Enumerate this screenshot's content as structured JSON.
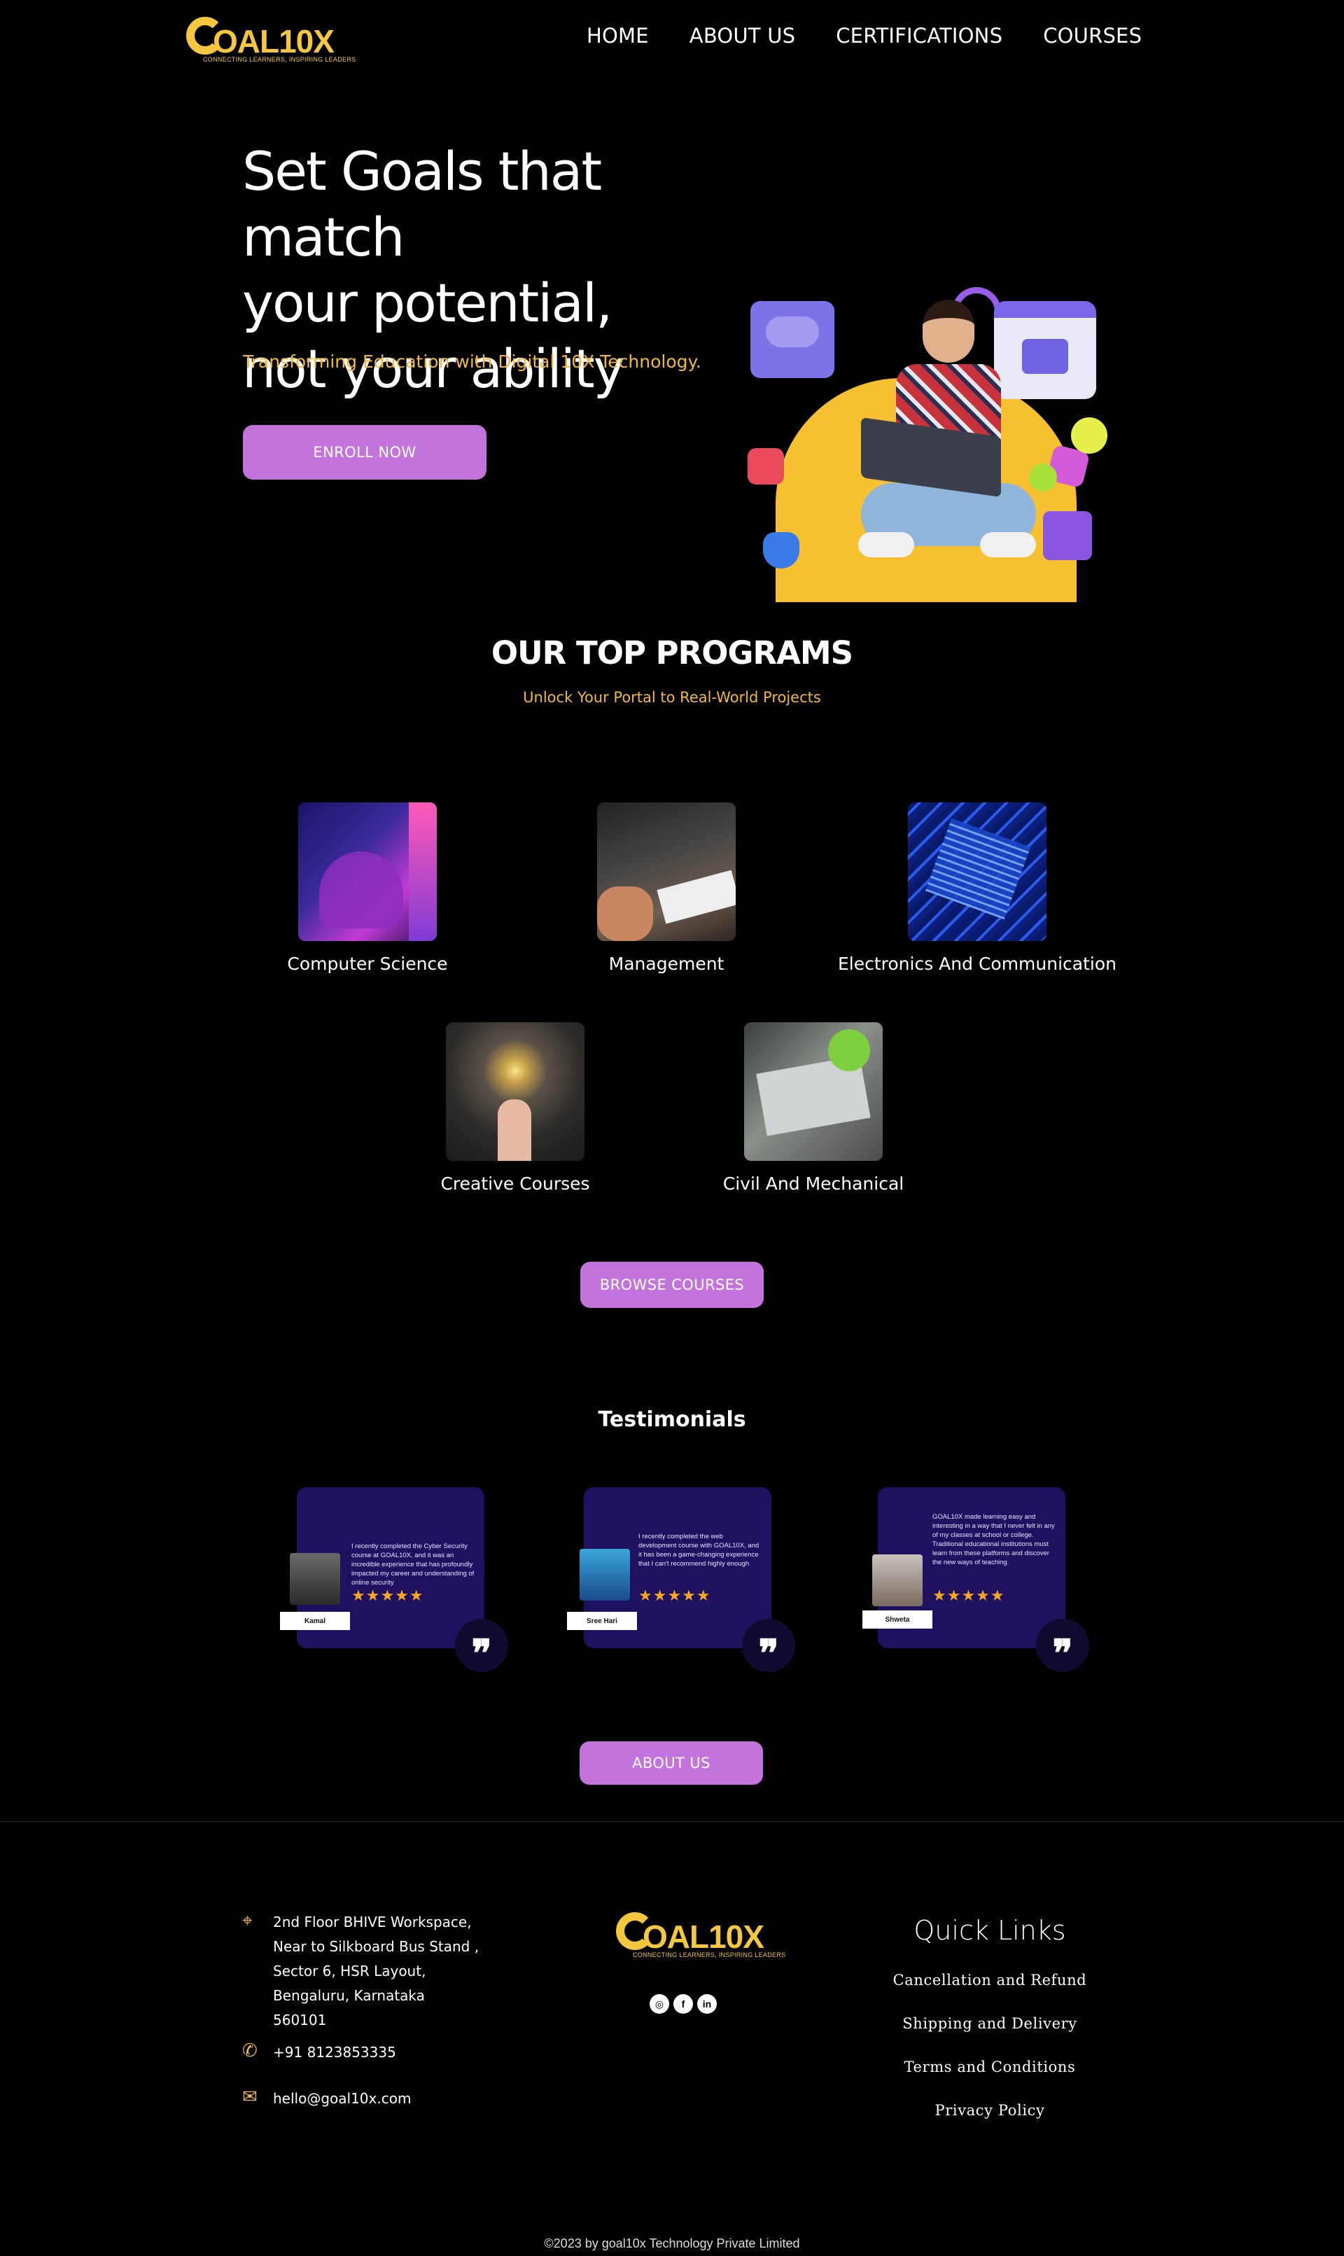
{
  "brand": {
    "logo_text": "OAL10X",
    "tagline": "CONNECTING LEARNERS, INSPIRING LEADERS"
  },
  "nav": {
    "items": [
      {
        "label": "HOME"
      },
      {
        "label": "ABOUT US"
      },
      {
        "label": "CERTIFICATIONS"
      },
      {
        "label": "COURSES"
      }
    ]
  },
  "hero": {
    "title_lines": [
      "Set Goals that match",
      "your potential,",
      "not your ability"
    ],
    "subtitle": "Transforming Education with Digital 10X Technology.",
    "cta_label": "ENROLL NOW"
  },
  "programs": {
    "title": "OUR TOP PROGRAMS",
    "subtitle": "Unlock Your Portal to Real-World Projects",
    "items": [
      {
        "label": "Computer Science"
      },
      {
        "label": "Management"
      },
      {
        "label": "Electronics And Communication"
      },
      {
        "label": "Creative Courses"
      },
      {
        "label": "Civil And Mechanical"
      }
    ],
    "cta_label": "BROWSE COURSES"
  },
  "testimonials": {
    "title": "Testimonials",
    "items": [
      {
        "name": "Kamal",
        "text": "I recently completed the Cyber Security course at GOAL10X, and it was an incredible experience that has profoundly impacted my career and understanding of online security",
        "stars": "★★★★★"
      },
      {
        "name": "Sree Hari",
        "text": "I recently completed the web development course with GOAL10X, and it has been a game-changing experience that I can't recommend highly enough",
        "stars": "★★★★★"
      },
      {
        "name": "Shweta",
        "text": "GOAL10X made learning easy and interesting in a way that I never felt in any of my classes at school or college. Traditional educational institutions must learn from these platforms and discover the new ways of teaching.",
        "stars": "★★★★★"
      }
    ],
    "quote_glyph": "❞"
  },
  "about_cta": "ABOUT US",
  "footer": {
    "address_lines": [
      "2nd Floor BHIVE Workspace,",
      "Near to Silkboard Bus Stand ,",
      "Sector 6, HSR Layout,",
      "Bengaluru, Karnataka",
      "560101"
    ],
    "phone": "+91 8123853335",
    "email": "hello@goal10x.com",
    "socials": [
      {
        "icon": "instagram-icon",
        "glyph": "◎"
      },
      {
        "icon": "facebook-icon",
        "glyph": "f"
      },
      {
        "icon": "linkedin-icon",
        "glyph": "in"
      }
    ],
    "quick_links_title": "Quick Links",
    "quick_links": [
      {
        "label": "Cancellation and Refund"
      },
      {
        "label": "Shipping and Delivery"
      },
      {
        "label": "Terms and Conditions"
      },
      {
        "label": "Privacy Policy"
      }
    ],
    "copyright": "©2023 by goal10x Technology Private Limited"
  },
  "colors": {
    "background": "#000000",
    "accent_purple": "#c374dc",
    "accent_gold": "#f4b83e",
    "card_navy": "#1f1060"
  }
}
